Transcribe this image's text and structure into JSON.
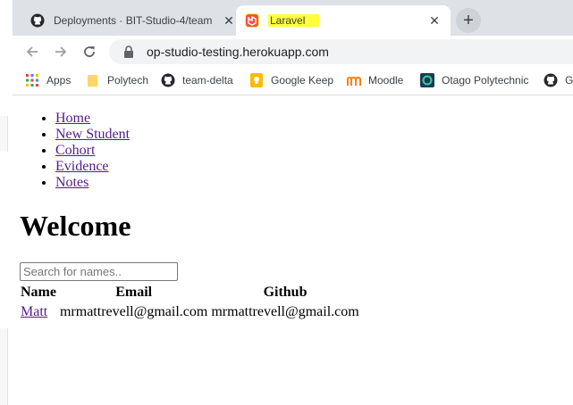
{
  "browser": {
    "tabs": [
      {
        "title": "Deployments · BIT-Studio-4/team",
        "close": "✕"
      },
      {
        "title": "Laravel",
        "close": "✕"
      }
    ],
    "new_tab": "+",
    "url": "op-studio-testing.herokuapp.com",
    "bookmarks": [
      "Apps",
      "Polytech",
      "team-delta",
      "Google Keep",
      "Moodle",
      "Otago Polytechnic",
      "Gi"
    ]
  },
  "page": {
    "nav": [
      "Home",
      "New Student",
      "Cohort",
      "Evidence",
      "Notes"
    ],
    "heading": "Welcome",
    "search_placeholder": "Search for names..",
    "table": {
      "headers": [
        "Name",
        "Email",
        "Github"
      ],
      "rows": [
        [
          "Matt",
          "mrmattrevell@gmail.com",
          "mrmattrevell@gmail.com"
        ]
      ]
    }
  },
  "colors": {
    "tab_highlight": "#ffff3a",
    "link": "#551a8b",
    "chrome_bg": "#dee1e6"
  }
}
